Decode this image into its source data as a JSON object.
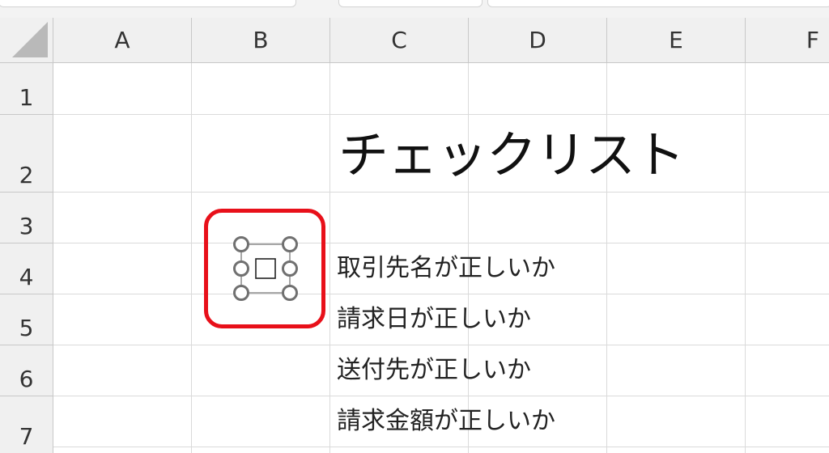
{
  "columns": [
    "A",
    "B",
    "C",
    "D",
    "E",
    "F"
  ],
  "rows": [
    "1",
    "2",
    "3",
    "4",
    "5",
    "6",
    "7"
  ],
  "sheet": {
    "title": "チェックリスト",
    "items": [
      "取引先名が正しいか",
      "請求日が正しいか",
      "送付先が正しいか",
      "請求金額が正しいか"
    ]
  },
  "checkbox_control": {
    "label": "□"
  },
  "colors": {
    "highlight": "#e8101a",
    "handle": "#707070",
    "grid": "#dadada",
    "header_bg": "#f0f0f0"
  }
}
